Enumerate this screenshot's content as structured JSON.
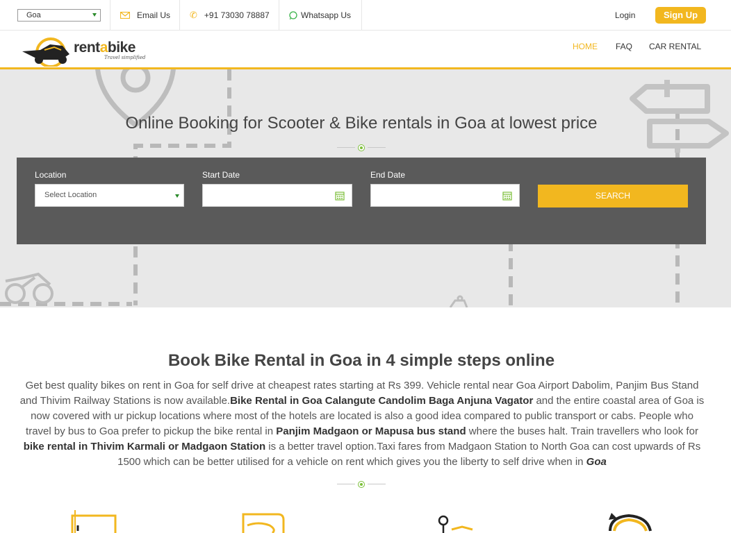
{
  "topbar": {
    "city_selected": "Goa",
    "email_label": "Email Us",
    "phone_label": "+91 73030 78887",
    "whatsapp_label": "Whatsapp Us",
    "login_label": "Login",
    "signup_label": "Sign Up"
  },
  "brand": {
    "name_part1": "rent",
    "name_part2": "a",
    "name_part3": "bike",
    "tagline": "Travel simplified",
    "accent_color": "#f2b71f"
  },
  "nav": {
    "items": [
      {
        "label": "HOME",
        "active": true
      },
      {
        "label": "FAQ",
        "active": false
      },
      {
        "label": "CAR RENTAL",
        "active": false
      }
    ]
  },
  "hero": {
    "title": "Online Booking for Scooter & Bike rentals in Goa at lowest price"
  },
  "search": {
    "location_label": "Location",
    "location_placeholder": "Select Location",
    "start_label": "Start Date",
    "start_value": "",
    "end_label": "End Date",
    "end_value": "",
    "button_label": "SEARCH"
  },
  "content": {
    "title": "Book Bike Rental in Goa in 4 simple steps online",
    "p1": "Get best quality bikes on rent in Goa for self drive at cheapest rates starting at Rs 399. Vehicle rental near Goa Airport Dabolim, Panjim Bus Stand and Thivim Railway Stations is now available.",
    "b1": "Bike Rental in Goa Calangute Candolim Baga Anjuna Vagator",
    "p2": " and the entire coastal area of Goa is now covered with ur pickup locations where most of the hotels are located is also a good idea compared to public transport or cabs. People who travel by bus to Goa prefer to pickup the bike rental in ",
    "b2": "Panjim Madgaon or Mapusa bus stand",
    "p3": " where the buses halt. Train travellers who look for ",
    "b3": "bike rental in Thivim Karmali or Madgaon Station",
    "p4": " is a better travel option.Taxi fares from Madgaon Station to North Goa can cost upwards of Rs 1500 which can be better utilised for a vehicle on rent which gives you the liberty to self drive when in ",
    "b4": "Goa"
  }
}
